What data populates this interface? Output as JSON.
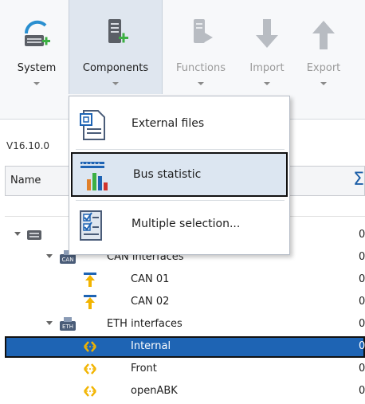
{
  "ribbon": {
    "buttons": [
      {
        "label": "System",
        "icon": "system-icon",
        "state": "normal"
      },
      {
        "label": "Components",
        "icon": "components-icon",
        "state": "active"
      },
      {
        "label": "Functions",
        "icon": "functions-icon",
        "state": "disabled"
      },
      {
        "label": "Import",
        "icon": "import-icon",
        "state": "disabled"
      },
      {
        "label": "Export",
        "icon": "export-icon",
        "state": "disabled"
      }
    ]
  },
  "version": "V16.10.0",
  "grid": {
    "header_name": "Name",
    "header_sum": "Σ",
    "rows": [
      {
        "label": "",
        "value": "0"
      },
      {
        "label": "CAN interfaces",
        "value": "0"
      },
      {
        "label": "CAN 01",
        "value": "0"
      },
      {
        "label": "CAN 02",
        "value": "0"
      },
      {
        "label": "ETH interfaces",
        "value": "0"
      },
      {
        "label": "Internal",
        "value": "0"
      },
      {
        "label": "Front",
        "value": "0"
      },
      {
        "label": "openABK",
        "value": "0"
      }
    ]
  },
  "menu": {
    "items": [
      {
        "label": "External files",
        "icon": "document-icon"
      },
      {
        "label": "Bus statistic",
        "icon": "bar-chart-icon"
      },
      {
        "label": "Multiple selection...",
        "icon": "checklist-icon"
      }
    ]
  },
  "colors": {
    "selection": "#1e64b4",
    "menu_highlight": "#dce6f1",
    "accent_green": "#3cb043",
    "ribbon_active": "#dfe6ef"
  }
}
